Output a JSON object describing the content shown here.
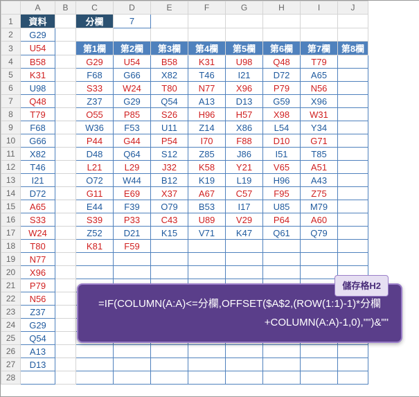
{
  "columns": [
    "",
    "A",
    "B",
    "C",
    "D",
    "E",
    "F",
    "G",
    "H",
    "I",
    "J"
  ],
  "labels": {
    "data_header": "資料",
    "split_label": "分欄",
    "split_value": "7",
    "col_headers": [
      "第1欄",
      "第2欄",
      "第3欄",
      "第4欄",
      "第5欄",
      "第6欄",
      "第7欄",
      "第8欄"
    ]
  },
  "colA": [
    "G29",
    "U54",
    "B58",
    "K31",
    "U98",
    "Q48",
    "T79",
    "F68",
    "G66",
    "X82",
    "T46",
    "I21",
    "D72",
    "A65",
    "S33",
    "W24",
    "T80",
    "N77",
    "X96",
    "P79",
    "N56",
    "Z37",
    "G29",
    "Q54",
    "A13",
    "D13",
    ""
  ],
  "grid": [
    [
      "G29",
      "U54",
      "B58",
      "K31",
      "U98",
      "Q48",
      "T79"
    ],
    [
      "F68",
      "G66",
      "X82",
      "T46",
      "I21",
      "D72",
      "A65"
    ],
    [
      "S33",
      "W24",
      "T80",
      "N77",
      "X96",
      "P79",
      "N56"
    ],
    [
      "Z37",
      "G29",
      "Q54",
      "A13",
      "D13",
      "G59",
      "X96"
    ],
    [
      "O55",
      "P85",
      "S26",
      "H96",
      "H57",
      "X98",
      "W31"
    ],
    [
      "W36",
      "F53",
      "U11",
      "Z14",
      "X86",
      "L54",
      "Y34"
    ],
    [
      "P44",
      "G44",
      "P54",
      "I70",
      "F88",
      "D10",
      "G71"
    ],
    [
      "D48",
      "Q64",
      "S12",
      "Z85",
      "J86",
      "I51",
      "T85"
    ],
    [
      "L21",
      "L29",
      "J32",
      "K58",
      "Y21",
      "V65",
      "A51"
    ],
    [
      "O72",
      "W44",
      "B12",
      "K19",
      "L19",
      "H96",
      "A43"
    ],
    [
      "G11",
      "E69",
      "X37",
      "A67",
      "C57",
      "F95",
      "Z75"
    ],
    [
      "E44",
      "F39",
      "O79",
      "B53",
      "I17",
      "U85",
      "M79"
    ],
    [
      "S39",
      "P33",
      "C43",
      "U89",
      "V29",
      "P64",
      "A60"
    ],
    [
      "Z52",
      "D21",
      "K15",
      "V71",
      "K47",
      "Q61",
      "Q79"
    ],
    [
      "K81",
      "F59",
      "",
      "",
      "",
      "",
      ""
    ]
  ],
  "redMask": [
    [
      1,
      1,
      1,
      1,
      1,
      1,
      1
    ],
    [
      0,
      0,
      0,
      0,
      0,
      0,
      0
    ],
    [
      1,
      1,
      1,
      1,
      1,
      1,
      1
    ],
    [
      0,
      0,
      0,
      0,
      0,
      0,
      0
    ],
    [
      1,
      1,
      1,
      1,
      1,
      1,
      1
    ],
    [
      0,
      0,
      0,
      0,
      0,
      0,
      0
    ],
    [
      1,
      1,
      1,
      1,
      1,
      1,
      1
    ],
    [
      0,
      0,
      0,
      0,
      0,
      0,
      0
    ],
    [
      1,
      1,
      1,
      1,
      1,
      1,
      1
    ],
    [
      0,
      0,
      0,
      0,
      0,
      0,
      0
    ],
    [
      1,
      1,
      1,
      1,
      1,
      1,
      1
    ],
    [
      0,
      0,
      0,
      0,
      0,
      0,
      0
    ],
    [
      1,
      1,
      1,
      1,
      1,
      1,
      1
    ],
    [
      0,
      0,
      0,
      0,
      0,
      0,
      0
    ],
    [
      1,
      1,
      0,
      0,
      0,
      0,
      0
    ]
  ],
  "tooltip": {
    "label": "儲存格H2",
    "line1": "=IF(COLUMN(A:A)<=分欄,OFFSET($A$2,(ROW(1:1)-1)*分欄",
    "line2": "+COLUMN(A:A)-1,0),\"\")&\"\""
  },
  "chart_data": {
    "type": "table",
    "title": "",
    "note": "Spreadsheet showing a single column of data (資料) in A being redistributed into N columns (分欄=7) using OFFSET formula",
    "source_column": [
      "G29",
      "U54",
      "B58",
      "K31",
      "U98",
      "Q48",
      "T79",
      "F68",
      "G66",
      "X82",
      "T46",
      "I21",
      "D72",
      "A65",
      "S33",
      "W24",
      "T80",
      "N77",
      "X96",
      "P79",
      "N56",
      "Z37",
      "G29",
      "Q54",
      "A13",
      "D13"
    ],
    "split_columns": 7,
    "result_rows": [
      [
        "G29",
        "U54",
        "B58",
        "K31",
        "U98",
        "Q48",
        "T79"
      ],
      [
        "F68",
        "G66",
        "X82",
        "T46",
        "I21",
        "D72",
        "A65"
      ],
      [
        "S33",
        "W24",
        "T80",
        "N77",
        "X96",
        "P79",
        "N56"
      ],
      [
        "Z37",
        "G29",
        "Q54",
        "A13",
        "D13",
        "G59",
        "X96"
      ],
      [
        "O55",
        "P85",
        "S26",
        "H96",
        "H57",
        "X98",
        "W31"
      ],
      [
        "W36",
        "F53",
        "U11",
        "Z14",
        "X86",
        "L54",
        "Y34"
      ],
      [
        "P44",
        "G44",
        "P54",
        "I70",
        "F88",
        "D10",
        "G71"
      ],
      [
        "D48",
        "Q64",
        "S12",
        "Z85",
        "J86",
        "I51",
        "T85"
      ],
      [
        "L21",
        "L29",
        "J32",
        "K58",
        "Y21",
        "V65",
        "A51"
      ],
      [
        "O72",
        "W44",
        "B12",
        "K19",
        "L19",
        "H96",
        "A43"
      ],
      [
        "G11",
        "E69",
        "X37",
        "A67",
        "C57",
        "F95",
        "Z75"
      ],
      [
        "E44",
        "F39",
        "O79",
        "B53",
        "I17",
        "U85",
        "M79"
      ],
      [
        "S39",
        "P33",
        "C43",
        "U89",
        "V29",
        "P64",
        "A60"
      ],
      [
        "Z52",
        "D21",
        "K15",
        "V71",
        "K47",
        "Q61",
        "Q79"
      ],
      [
        "K81",
        "F59",
        "",
        "",
        "",
        "",
        ""
      ]
    ]
  }
}
